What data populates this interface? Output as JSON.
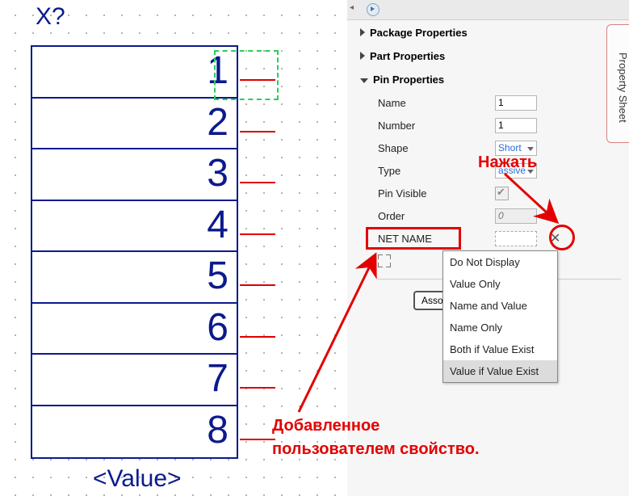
{
  "canvas": {
    "refdes": "X?",
    "value_placeholder": "<Value>",
    "pins": [
      "1",
      "2",
      "3",
      "4",
      "5",
      "6",
      "7",
      "8"
    ]
  },
  "panel": {
    "tab_label": "Property Sheet",
    "sect_package": "Package Properties",
    "sect_part": "Part Properties",
    "sect_pin": "Pin Properties",
    "rows": {
      "name_lbl": "Name",
      "name_val": "1",
      "number_lbl": "Number",
      "number_val": "1",
      "shape_lbl": "Shape",
      "shape_val": "Short",
      "type_lbl": "Type",
      "type_val": "assive",
      "pinvis_lbl": "Pin Visible",
      "order_lbl": "Order",
      "order_val": "0",
      "netname_lbl": "NET NAME"
    },
    "assoc_btn": "Assoc",
    "dropdown": [
      "Do Not Display",
      "Value Only",
      "Name and Value",
      "Name Only",
      "Both if Value Exist",
      "Value if Value Exist"
    ]
  },
  "annot": {
    "press": "Нажать",
    "added1": "Добавленное",
    "added2": "пользователем свойство."
  }
}
